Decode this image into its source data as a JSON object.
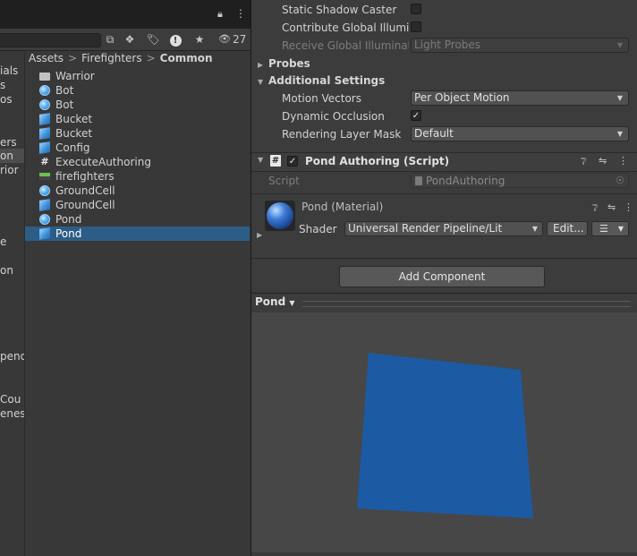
{
  "project": {
    "top_icons": {
      "lock": "lock-icon",
      "menu": "kebab-icon"
    },
    "toolbar": {
      "visibility_count": "27"
    },
    "folder_tree": [
      "ials",
      "s",
      "os",
      "ers",
      "on",
      "rior",
      "e",
      "on",
      "pend",
      "Cou",
      "enes"
    ],
    "breadcrumb": [
      "Assets",
      "Firefighters",
      "Common"
    ],
    "assets": [
      {
        "label": "Warrior",
        "icon": "folder-icon"
      },
      {
        "label": "Bot",
        "icon": "sphere-icon"
      },
      {
        "label": "Bot",
        "icon": "sphere-icon"
      },
      {
        "label": "Bucket",
        "icon": "prefab-icon"
      },
      {
        "label": "Bucket",
        "icon": "prefab-icon"
      },
      {
        "label": "Config",
        "icon": "prefab-icon"
      },
      {
        "label": "ExecuteAuthoring",
        "icon": "script-icon"
      },
      {
        "label": "firefighters",
        "icon": "scene-icon"
      },
      {
        "label": "GroundCell",
        "icon": "sphere-icon"
      },
      {
        "label": "GroundCell",
        "icon": "prefab-icon"
      },
      {
        "label": "Pond",
        "icon": "sphere-icon"
      },
      {
        "label": "Pond",
        "icon": "prefab-icon",
        "selected": true
      }
    ]
  },
  "inspector": {
    "static_shadow_caster": "Static Shadow Caster",
    "contribute_gi": "Contribute Global Illumina",
    "receive_gi": "Receive Global Illuminatic",
    "receive_gi_value": "Light Probes",
    "probes": "Probes",
    "additional_settings": "Additional Settings",
    "motion_vectors": "Motion Vectors",
    "motion_vectors_value": "Per Object Motion",
    "dynamic_occlusion": "Dynamic Occlusion",
    "rendering_layer_mask": "Rendering Layer Mask",
    "rendering_layer_mask_value": "Default",
    "component_title": "Pond Authoring (Script)",
    "script_label": "Script",
    "script_value": "PondAuthoring",
    "material_title": "Pond (Material)",
    "shader_label": "Shader",
    "shader_value": "Universal Render Pipeline/Lit",
    "edit_button": "Edit...",
    "add_component": "Add Component"
  },
  "preview": {
    "label": "Pond",
    "quad_color": "#1c5aa4"
  }
}
